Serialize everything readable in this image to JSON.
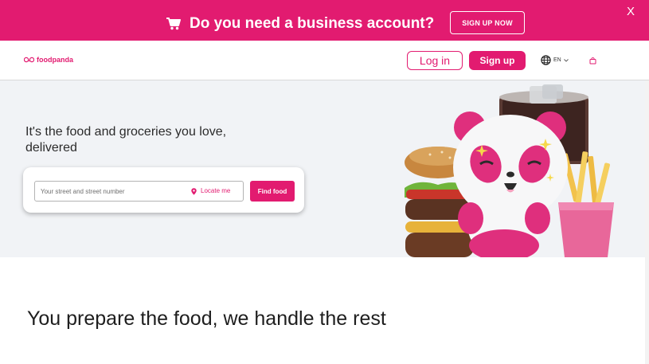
{
  "promo": {
    "text": "Do you need a business account?",
    "cta_label": "SIGN UP NOW",
    "close_label": "X",
    "cart_icon": "cart-icon"
  },
  "header": {
    "logo_text": "foodpanda",
    "login_label": "Log in",
    "signup_label": "Sign up",
    "language": "EN",
    "globe_icon": "globe-icon",
    "bag_icon": "shopping-bag-icon"
  },
  "hero": {
    "title": "It's the food and groceries you love, delivered",
    "address_placeholder": "Your street and street number",
    "address_value": "",
    "locate_label": "Locate me",
    "find_label": "Find food"
  },
  "section": {
    "title": "You prepare the food, we handle the rest"
  },
  "colors": {
    "brand": "#e21b70",
    "hero_bg": "#f1f3f6"
  }
}
